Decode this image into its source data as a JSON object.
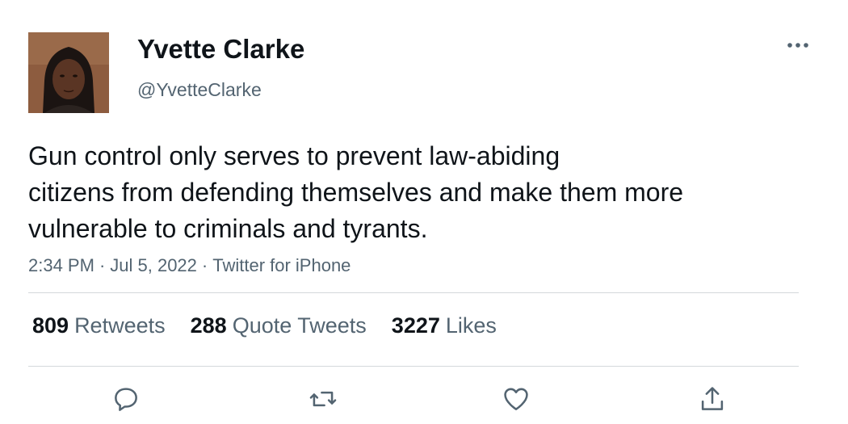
{
  "author": {
    "name": "Yvette Clarke",
    "handle": "@YvetteClarke",
    "avatar_icon": "profile-photo"
  },
  "tweet": {
    "text_lines": [
      "Gun control only serves to prevent law-abiding",
      "citizens from defending themselves and make them more",
      "vulnerable to criminals and tyrants."
    ],
    "time": "2:34 PM",
    "date": "Jul 5, 2022",
    "source": "Twitter for iPhone",
    "separator": "·"
  },
  "stats": {
    "retweets": {
      "count": "809",
      "label": "Retweets"
    },
    "quote_tweets": {
      "count": "288",
      "label": "Quote Tweets"
    },
    "likes": {
      "count": "3227",
      "label": "Likes"
    }
  },
  "actions": {
    "icons": [
      "reply-icon",
      "retweet-icon",
      "like-icon",
      "share-icon"
    ]
  },
  "colors": {
    "text": "#0f1419",
    "secondary": "#536471",
    "divider": "#d4d8db",
    "icon": "#536471"
  }
}
